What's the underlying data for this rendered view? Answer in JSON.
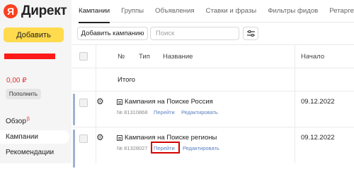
{
  "app": {
    "logo_letter": "Я",
    "logo_text": "Директ",
    "brand_color": "#fc3f1d",
    "accent_color": "#ffdb4d"
  },
  "sidebar": {
    "add_button": "Добавить",
    "balance": "0,00 ₽",
    "topup_button": "Пополнить",
    "nav": [
      {
        "label": "Обзор",
        "badge": "β"
      },
      {
        "label": "Кампании"
      },
      {
        "label": "Рекомендации"
      }
    ]
  },
  "tabs": [
    "Кампании",
    "Группы",
    "Объявления",
    "Ставки и фразы",
    "Фильтры фидов",
    "Ретаргет"
  ],
  "toolbar": {
    "add_campaign": "Добавить кампанию",
    "search_placeholder": "Поиск",
    "filter_icon": "sliders-icon"
  },
  "table": {
    "columns": [
      "№",
      "Тип",
      "Название",
      "Начало"
    ],
    "total_label": "Итого",
    "rows": [
      {
        "name": "Кампания на Поиске Россия",
        "number": "№ 81310868",
        "goto": "Перейти",
        "edit": "Редактировать",
        "start": "09.12.2022"
      },
      {
        "name": "Кампания на Поиске регионы",
        "number": "№ 81328027",
        "goto": "Перейти",
        "edit": "Редактировать",
        "start": "09.12.2022"
      }
    ]
  }
}
